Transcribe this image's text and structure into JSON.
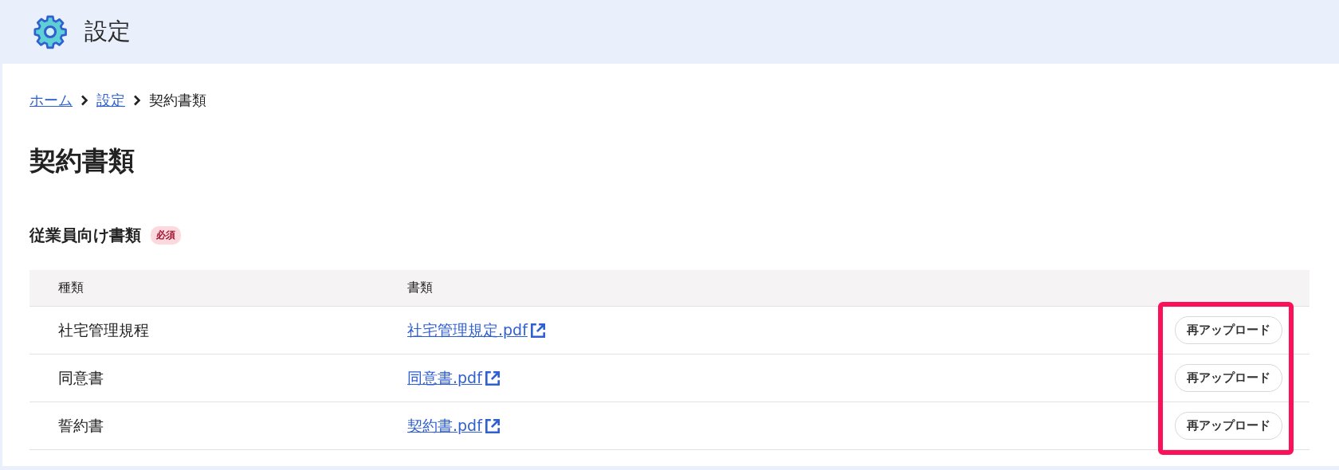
{
  "header": {
    "title": "設定"
  },
  "breadcrumb": [
    {
      "label": "ホーム",
      "link": true
    },
    {
      "label": "設定",
      "link": true
    },
    {
      "label": "契約書類",
      "link": false
    }
  ],
  "page_title": "契約書類",
  "section": {
    "title": "従業員向け書類",
    "badge": "必須"
  },
  "table": {
    "columns": [
      "種類",
      "書類"
    ],
    "actions_highlighted": true,
    "rows": [
      {
        "type": "社宅管理規程",
        "document": "社宅管理規定.pdf",
        "action": "再アップロード"
      },
      {
        "type": "同意書",
        "document": "同意書.pdf",
        "action": "再アップロード"
      },
      {
        "type": "誓約書",
        "document": "契約書.pdf",
        "action": "再アップロード"
      }
    ]
  }
}
